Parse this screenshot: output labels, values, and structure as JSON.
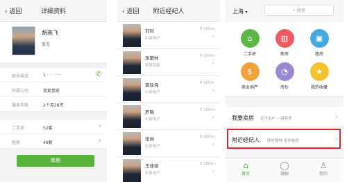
{
  "screen1": {
    "back": "返回",
    "title": "详细资料",
    "name": "胡燕飞",
    "nickname": "暂无",
    "rows": [
      {
        "key": "联系电话",
        "value": "1 · ·  ·  ·  · ·"
      },
      {
        "key": "所属公司",
        "value": "我爱我家"
      },
      {
        "key": "服务年限",
        "value": "2个月28天"
      }
    ],
    "listings": [
      {
        "key": "二手房",
        "value": "52套"
      },
      {
        "key": "租房",
        "value": "48套"
      }
    ],
    "call_button": "致期"
  },
  "screen2": {
    "back": "返回",
    "title": "附近经纪人",
    "agents": [
      {
        "name": "刘钊",
        "company": "中原地产",
        "distance": "100m"
      },
      {
        "name": "张跟林",
        "company": "我爱我家",
        "distance": "100m"
      },
      {
        "name": "莫徐海",
        "company": "中原地产",
        "distance": "100m"
      },
      {
        "name": "罗暗",
        "company": "中原地产",
        "distance": "100m"
      },
      {
        "name": "张帅",
        "company": "中原地产",
        "distance": "100m"
      },
      {
        "name": "王佳佳",
        "company": "中原地产",
        "distance": "200m"
      }
    ]
  },
  "screen3": {
    "city": "上海",
    "search_placeholder": "搜索",
    "grid": [
      {
        "label": "二手房",
        "color": "#5cb746",
        "icon": "house-icon",
        "glyph": "⌂"
      },
      {
        "label": "新房",
        "color": "#ef5a60",
        "icon": "building-icon",
        "glyph": "▥"
      },
      {
        "label": "租房",
        "color": "#45a9df",
        "icon": "suitcase-icon",
        "glyph": "▣"
      },
      {
        "label": "商业地产",
        "color": "#f0a23c",
        "icon": "money-bag-icon",
        "glyph": "$"
      },
      {
        "label": "房价",
        "color": "#9b88d2",
        "icon": "chart-icon",
        "glyph": "◔"
      },
      {
        "label": "我的收藏",
        "color": "#f2c230",
        "icon": "star-icon",
        "glyph": "★"
      }
    ],
    "sell": {
      "main": "我要卖房",
      "sub": "足不出户 一键卖房"
    },
    "nearby": {
      "main": "附近经纪人",
      "sub": "随时随地 带你看房"
    },
    "tabs": [
      {
        "label": "首页",
        "icon": "home-icon",
        "glyph": "⌂",
        "active": true
      },
      {
        "label": "微聊",
        "icon": "chat-icon",
        "glyph": "◯",
        "active": false
      },
      {
        "label": "我的",
        "icon": "user-icon",
        "glyph": "♙",
        "active": false
      }
    ]
  }
}
